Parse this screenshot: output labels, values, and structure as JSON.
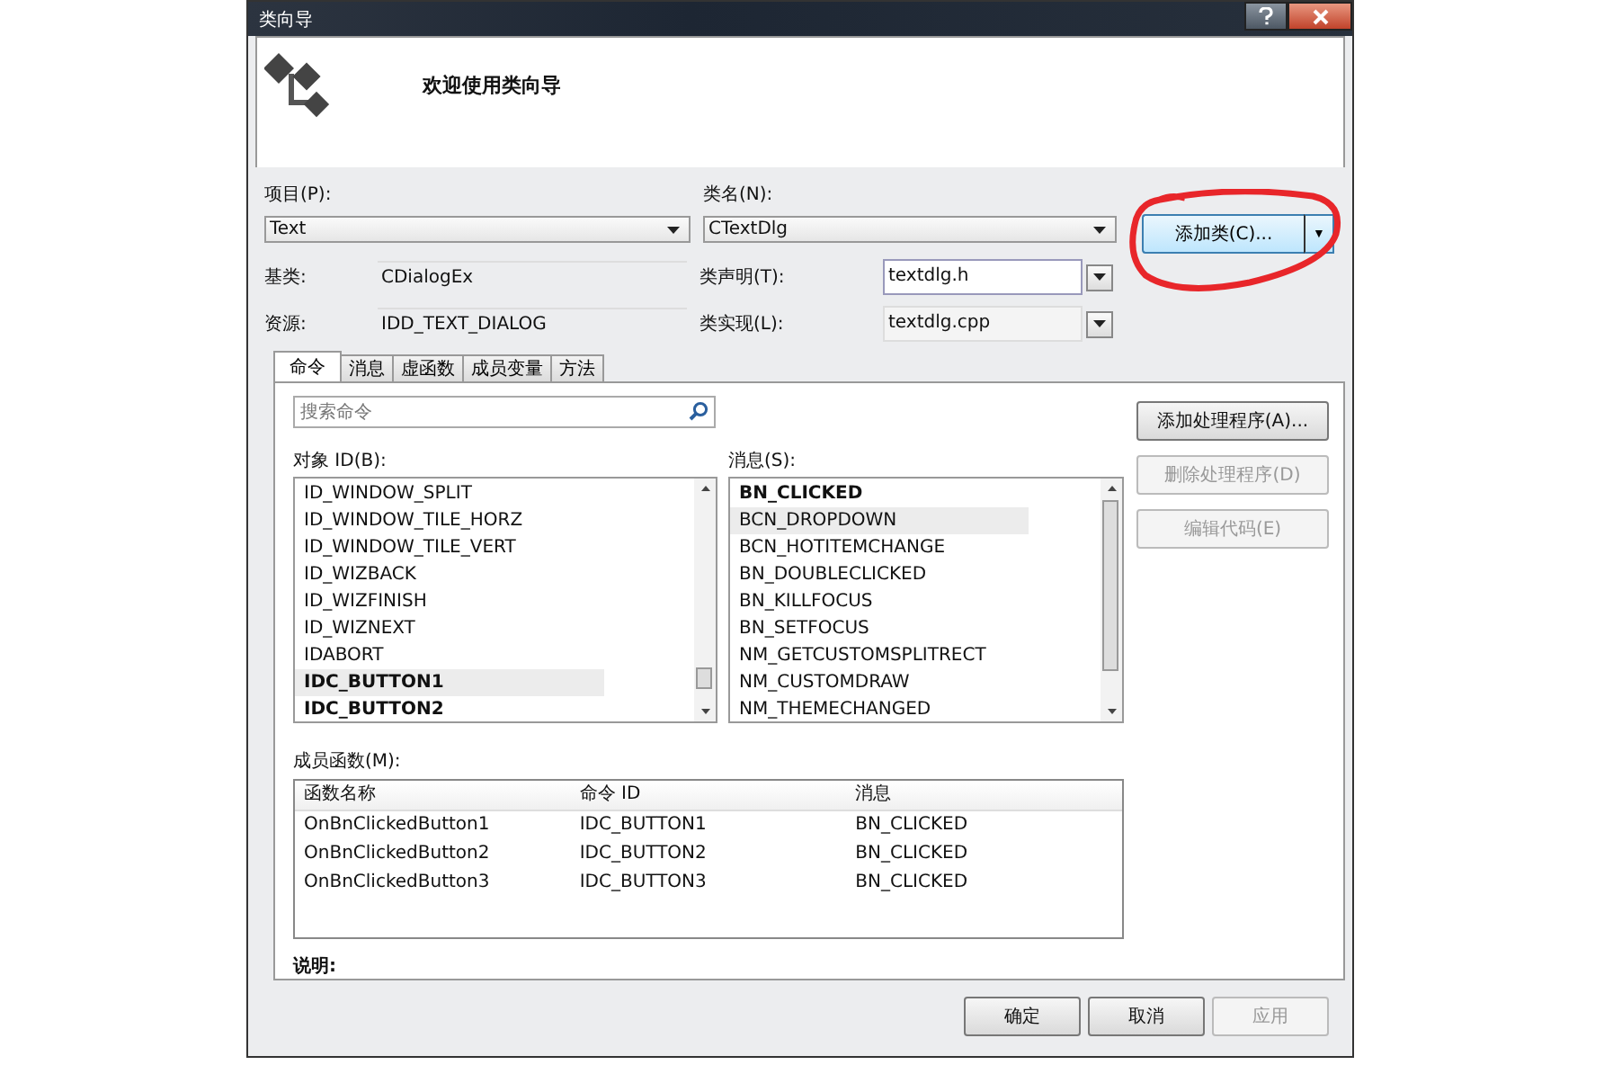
{
  "window": {
    "title": "类向导"
  },
  "header": {
    "title": "欢迎使用类向导"
  },
  "project": {
    "label": "项目(P):",
    "value": "Text"
  },
  "class_name": {
    "label": "类名(N):",
    "value": "CTextDlg"
  },
  "add_class_button": {
    "label": "添加类(C)...",
    "caret": "▼"
  },
  "base_class": {
    "label": "基类:",
    "value": "CDialogEx"
  },
  "resource": {
    "label": "资源:",
    "value": "IDD_TEXT_DIALOG"
  },
  "class_declaration": {
    "label": "类声明(T):",
    "value": "textdlg.h"
  },
  "class_implementation": {
    "label": "类实现(L):",
    "value": "textdlg.cpp"
  },
  "tabs": [
    {
      "label": "命令",
      "selected": true
    },
    {
      "label": "消息",
      "selected": false
    },
    {
      "label": "虚函数",
      "selected": false
    },
    {
      "label": "成员变量",
      "selected": false
    },
    {
      "label": "方法",
      "selected": false
    }
  ],
  "search": {
    "placeholder": "搜索命令"
  },
  "object_ids": {
    "label": "对象 ID(B):",
    "items": [
      {
        "text": "ID_WINDOW_SPLIT",
        "bold": false,
        "selected": false
      },
      {
        "text": "ID_WINDOW_TILE_HORZ",
        "bold": false,
        "selected": false
      },
      {
        "text": "ID_WINDOW_TILE_VERT",
        "bold": false,
        "selected": false
      },
      {
        "text": "ID_WIZBACK",
        "bold": false,
        "selected": false
      },
      {
        "text": "ID_WIZFINISH",
        "bold": false,
        "selected": false
      },
      {
        "text": "ID_WIZNEXT",
        "bold": false,
        "selected": false
      },
      {
        "text": "IDABORT",
        "bold": false,
        "selected": false
      },
      {
        "text": "IDC_BUTTON1",
        "bold": true,
        "selected": true
      },
      {
        "text": "IDC_BUTTON2",
        "bold": true,
        "selected": false
      }
    ]
  },
  "messages": {
    "label": "消息(S):",
    "items": [
      {
        "text": "BN_CLICKED",
        "bold": true,
        "selected": false
      },
      {
        "text": "BCN_DROPDOWN",
        "bold": false,
        "selected": true
      },
      {
        "text": "BCN_HOTITEMCHANGE",
        "bold": false,
        "selected": false
      },
      {
        "text": "BN_DOUBLECLICKED",
        "bold": false,
        "selected": false
      },
      {
        "text": "BN_KILLFOCUS",
        "bold": false,
        "selected": false
      },
      {
        "text": "BN_SETFOCUS",
        "bold": false,
        "selected": false
      },
      {
        "text": "NM_GETCUSTOMSPLITRECT",
        "bold": false,
        "selected": false
      },
      {
        "text": "NM_CUSTOMDRAW",
        "bold": false,
        "selected": false
      },
      {
        "text": "NM_THEMECHANGED",
        "bold": false,
        "selected": false
      }
    ]
  },
  "side_buttons": [
    {
      "label": "添加处理程序(A)...",
      "disabled": false
    },
    {
      "label": "删除处理程序(D)",
      "disabled": true
    },
    {
      "label": "编辑代码(E)",
      "disabled": true
    }
  ],
  "member_functions": {
    "label": "成员函数(M):",
    "columns": [
      "函数名称",
      "命令 ID",
      "消息"
    ],
    "rows": [
      [
        "OnBnClickedButton1",
        "IDC_BUTTON1",
        "BN_CLICKED"
      ],
      [
        "OnBnClickedButton2",
        "IDC_BUTTON2",
        "BN_CLICKED"
      ],
      [
        "OnBnClickedButton3",
        "IDC_BUTTON3",
        "BN_CLICKED"
      ]
    ]
  },
  "description": {
    "label": "说明:"
  },
  "dialog_buttons": [
    {
      "label": "确定",
      "disabled": false
    },
    {
      "label": "取消",
      "disabled": false
    },
    {
      "label": "应用",
      "disabled": true
    }
  ]
}
